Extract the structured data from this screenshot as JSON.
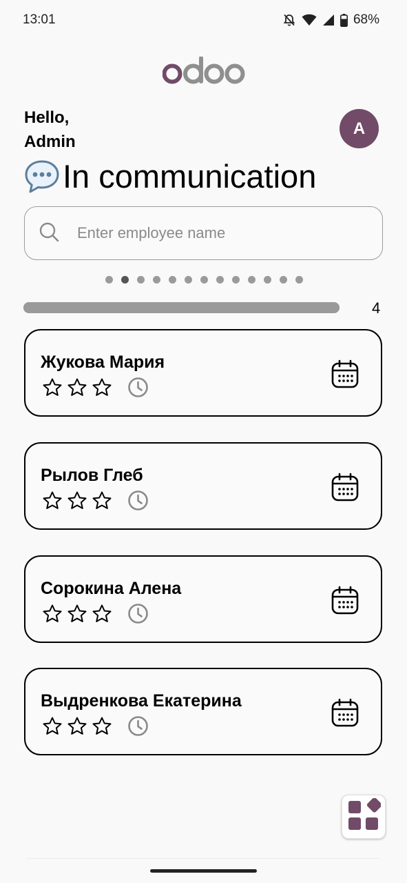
{
  "status_bar": {
    "time": "13:01",
    "battery": "68%",
    "icons": [
      "bell-off-icon",
      "wifi-icon",
      "cellular-signal-icon",
      "battery-icon"
    ]
  },
  "logo": {
    "text": "odoo",
    "colors": {
      "o1": "#714b67",
      "rest": "#8f8f8f"
    }
  },
  "greeting": {
    "line1": "Hello,",
    "line2": "Admin"
  },
  "avatar": {
    "initial": "A",
    "color": "#714b67"
  },
  "page": {
    "title": "In communication",
    "title_icon": "speech-bubble-icon"
  },
  "search": {
    "placeholder": "Enter employee name",
    "value": ""
  },
  "pager": {
    "total": 13,
    "active_index": 1
  },
  "progress": {
    "fraction": 1.0,
    "count": "4"
  },
  "employees": [
    {
      "name": "Жукова Мария",
      "stars": 0,
      "max_stars": 3
    },
    {
      "name": "Рылов Глеб",
      "stars": 0,
      "max_stars": 3
    },
    {
      "name": "Сорокина Алена",
      "stars": 0,
      "max_stars": 3
    },
    {
      "name": "Выдренкова Екатерина",
      "stars": 0,
      "max_stars": 3
    }
  ],
  "fab": {
    "icon": "apps-grid-icon",
    "color": "#714b67"
  }
}
